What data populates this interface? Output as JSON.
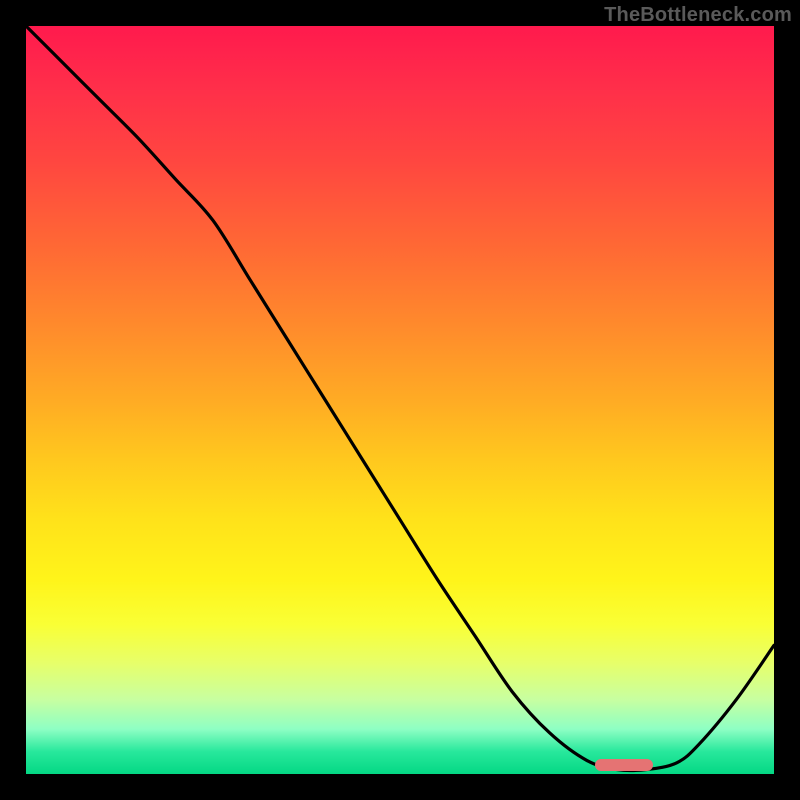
{
  "watermark": "TheBottleneck.com",
  "chart_data": {
    "type": "line",
    "title": "",
    "xlabel": "",
    "ylabel": "",
    "xlim": [
      0,
      100
    ],
    "ylim": [
      0,
      100
    ],
    "grid": false,
    "series": [
      {
        "name": "curve",
        "x": [
          0,
          5,
          10,
          15,
          20,
          25,
          30,
          35,
          40,
          45,
          50,
          55,
          60,
          65,
          70,
          75,
          79,
          83,
          87,
          90,
          95,
          100
        ],
        "values": [
          100,
          95,
          90,
          85,
          79.5,
          74,
          66,
          58,
          50,
          42,
          34,
          26,
          18.5,
          11,
          5.5,
          1.8,
          0.6,
          0.6,
          1.5,
          4,
          10,
          17.2
        ]
      }
    ],
    "marker": {
      "x": 80,
      "y": 1.2,
      "shape": "pill",
      "color": "#e57373"
    },
    "background_gradient": {
      "direction": "vertical",
      "stops": [
        {
          "pos": 0,
          "color": "#ff1a4d"
        },
        {
          "pos": 50,
          "color": "#ffab24"
        },
        {
          "pos": 80,
          "color": "#f9ff35"
        },
        {
          "pos": 100,
          "color": "#04d884"
        }
      ]
    }
  },
  "colors": {
    "frame": "#000000",
    "curve": "#000000",
    "marker": "#e57373",
    "watermark": "#5a5a5a"
  }
}
